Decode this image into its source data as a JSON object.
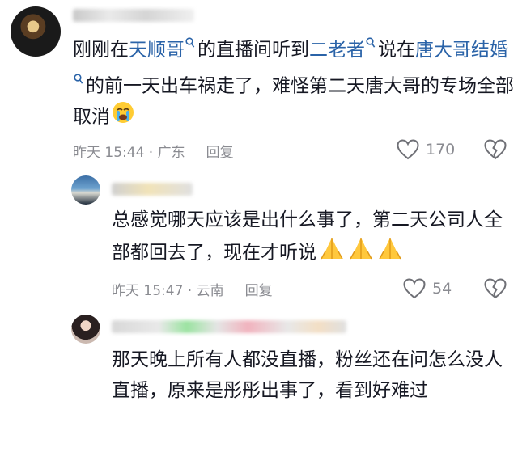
{
  "comments": [
    {
      "segments": [
        {
          "text": "刚刚在",
          "type": "text"
        },
        {
          "text": "天顺哥",
          "type": "link"
        },
        {
          "text": "的直播间听到",
          "type": "text"
        },
        {
          "text": "二老者",
          "type": "link"
        },
        {
          "text": "说在",
          "type": "text"
        },
        {
          "text": "唐大哥结婚",
          "type": "link"
        },
        {
          "text": "的前一天出车祸走了，难怪第二天唐大哥的专场全部取消",
          "type": "text"
        }
      ],
      "time": "昨天 15:44 · 广东",
      "reply_label": "回复",
      "likes": "170"
    },
    {
      "text": "总感觉哪天应该是出什么事了，第二天公司人全部都回去了，现在才听说",
      "time": "昨天 15:47 · 云南",
      "reply_label": "回复",
      "likes": "54"
    },
    {
      "text": "那天晚上所有人都没直播，粉丝还在问怎么没人直播，原来是彤彤出事了，看到好难过"
    }
  ],
  "icons": {
    "search": "search-icon",
    "like": "heart-outline-icon",
    "dislike": "broken-heart-icon",
    "crying": "crying-face-emoji",
    "pray": "folded-hands-emoji"
  },
  "colors": {
    "link": "#2a63a8",
    "meta": "#8a8b91",
    "text": "#161823"
  }
}
